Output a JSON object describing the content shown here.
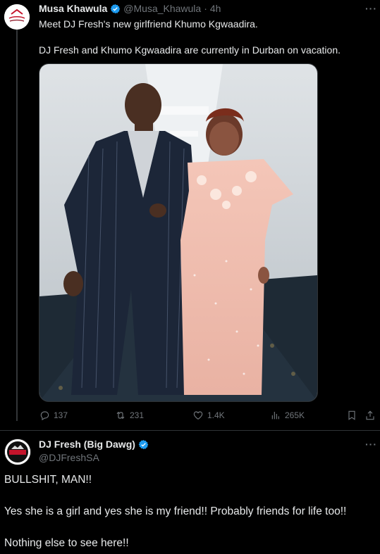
{
  "tweet1": {
    "name": "Musa Khawula",
    "handle": "@Musa_Khawula",
    "time_sep": "·",
    "time": "4h",
    "more": "···",
    "line1": "Meet DJ Fresh's new girlfriend Khumo Kgwaadira.",
    "line2": "DJ Fresh and Khumo Kgwaadira are currently in Durban on vacation.",
    "stats": {
      "replies": "137",
      "retweets": "231",
      "likes": "1.4K",
      "views": "265K"
    }
  },
  "tweet2": {
    "name": "DJ Fresh (Big Dawg)",
    "handle": "@DJFreshSA",
    "more": "···",
    "line1": "BULLSHIT, MAN!!",
    "line2": "Yes she is a girl and yes she is my friend!! Probably friends for life too!!",
    "line3": "Nothing else to see here!!"
  },
  "colors": {
    "background": "#000000",
    "text": "#e7e9ea",
    "muted": "#71767b",
    "verified": "#1d9bf0"
  }
}
